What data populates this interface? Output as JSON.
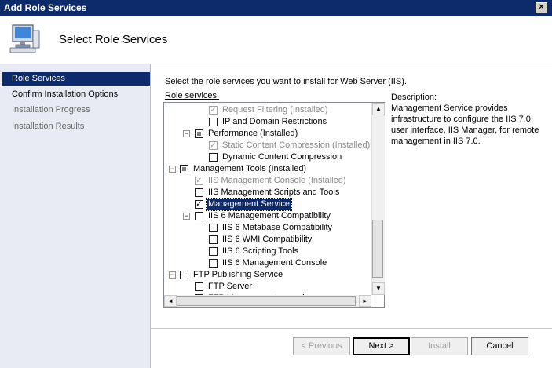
{
  "window": {
    "title": "Add Role Services",
    "close_label": "×"
  },
  "header": {
    "title": "Select Role Services",
    "icon": "computer-wizard-icon"
  },
  "nav": {
    "items": [
      {
        "label": "Role Services",
        "state": "active"
      },
      {
        "label": "Confirm Installation Options",
        "state": "normal"
      },
      {
        "label": "Installation Progress",
        "state": "dim"
      },
      {
        "label": "Installation Results",
        "state": "dim"
      }
    ]
  },
  "content": {
    "instruction": "Select the role services you want to install for Web Server (IIS).",
    "role_services_label": "Role services:",
    "description_heading": "Description:",
    "description_body": "Management Service provides infrastructure to configure the IIS 7.0 user interface, IIS Manager, for remote management in IIS 7.0."
  },
  "tree": [
    {
      "label": "Request Filtering  (Installed)",
      "checked": true,
      "disabled": true,
      "level": 2
    },
    {
      "label": "IP and Domain Restrictions",
      "checked": false,
      "disabled": false,
      "level": 2
    },
    {
      "label": "Performance  (Installed)",
      "checked": "partial",
      "disabled": false,
      "level": 1,
      "expander": "−"
    },
    {
      "label": "Static Content Compression  (Installed)",
      "checked": true,
      "disabled": true,
      "level": 2
    },
    {
      "label": "Dynamic Content Compression",
      "checked": false,
      "disabled": false,
      "level": 2
    },
    {
      "label": "Management Tools  (Installed)",
      "checked": "partial",
      "disabled": false,
      "level": 0,
      "expander": "−"
    },
    {
      "label": "IIS Management Console  (Installed)",
      "checked": true,
      "disabled": true,
      "level": 1
    },
    {
      "label": "IIS Management Scripts and Tools",
      "checked": false,
      "disabled": false,
      "level": 1
    },
    {
      "label": "Management Service",
      "checked": true,
      "disabled": false,
      "level": 1,
      "selected": true
    },
    {
      "label": "IIS 6 Management Compatibility",
      "checked": false,
      "disabled": false,
      "level": 1,
      "expander": "−"
    },
    {
      "label": "IIS 6 Metabase Compatibility",
      "checked": false,
      "disabled": false,
      "level": 2
    },
    {
      "label": "IIS 6 WMI Compatibility",
      "checked": false,
      "disabled": false,
      "level": 2
    },
    {
      "label": "IIS 6 Scripting Tools",
      "checked": false,
      "disabled": false,
      "level": 2
    },
    {
      "label": "IIS 6 Management Console",
      "checked": false,
      "disabled": false,
      "level": 2
    },
    {
      "label": "FTP Publishing Service",
      "checked": false,
      "disabled": false,
      "level": 0,
      "expander": "−"
    },
    {
      "label": "FTP Server",
      "checked": false,
      "disabled": false,
      "level": 1
    },
    {
      "label": "FTP Management console",
      "checked": false,
      "disabled": false,
      "level": 1
    }
  ],
  "buttons": {
    "previous": "< Previous",
    "next": "Next >",
    "install": "Install",
    "cancel": "Cancel"
  },
  "scroll_arrows": {
    "up": "▲",
    "down": "▼",
    "left": "◄",
    "right": "►"
  }
}
